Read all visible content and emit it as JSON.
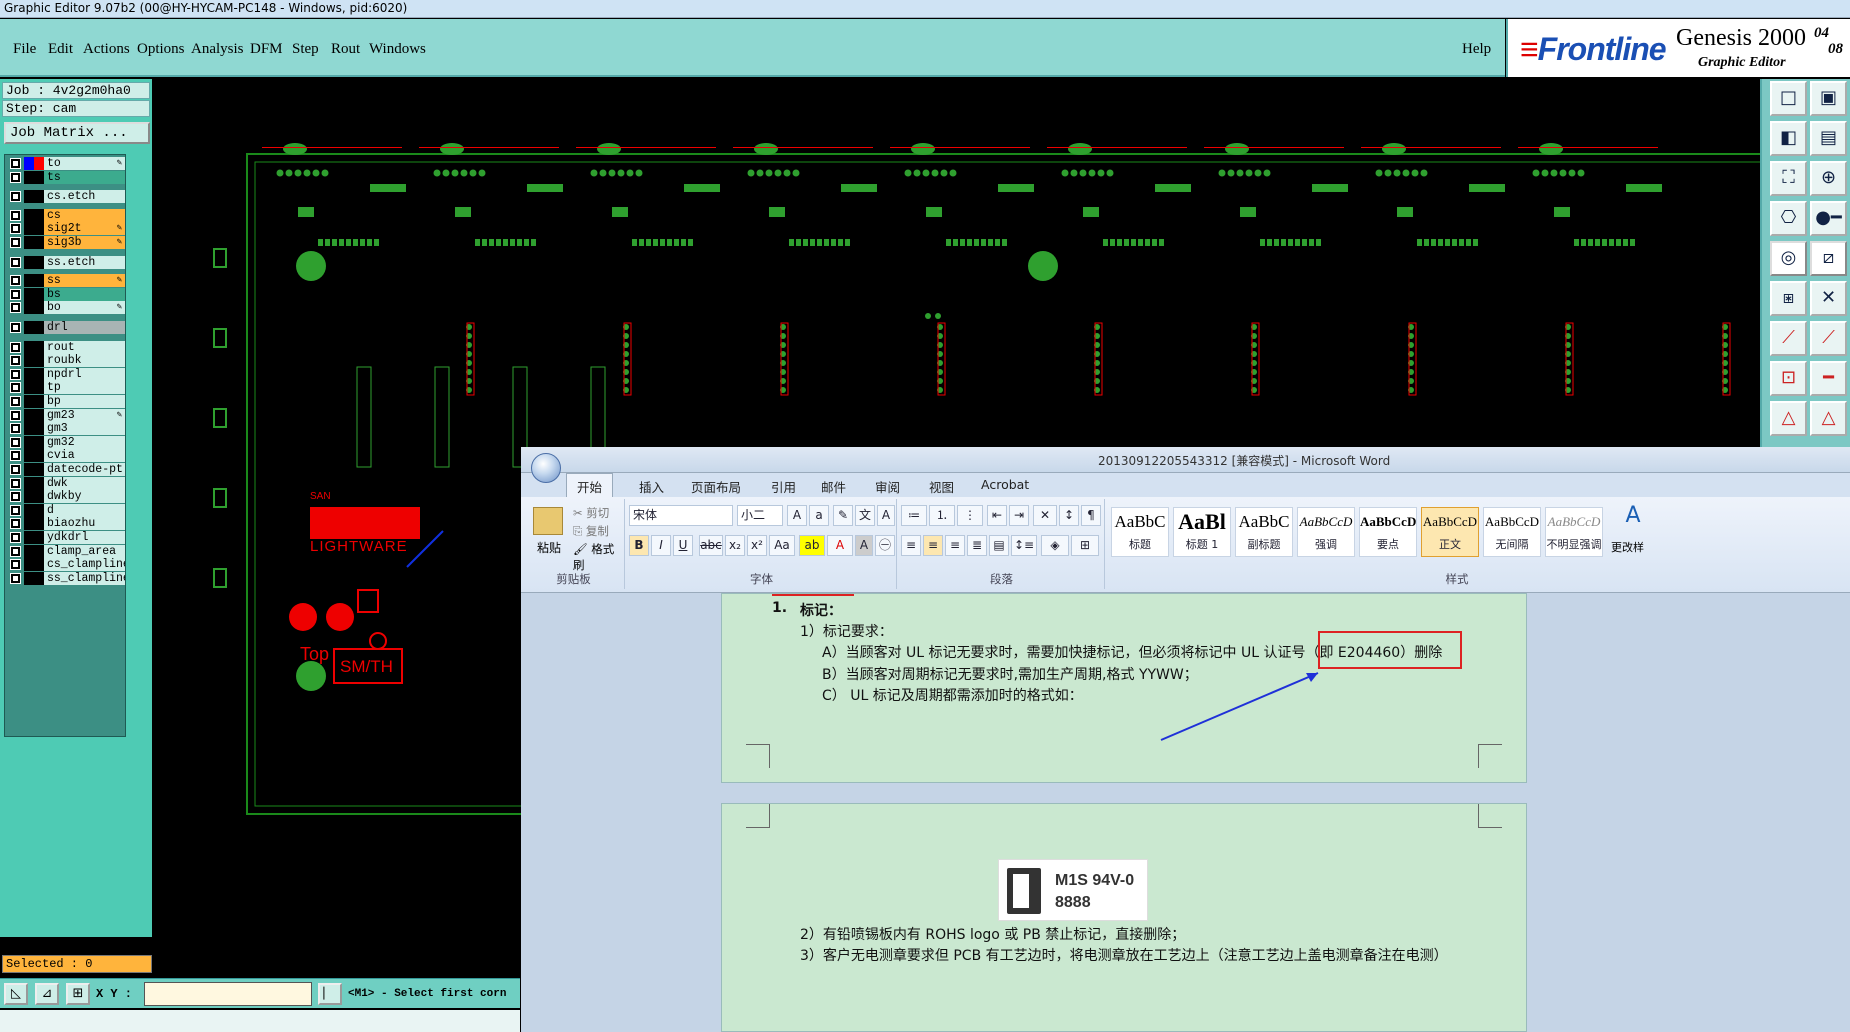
{
  "window": {
    "title": "Graphic Editor 9.07b2 (00@HY-HYCAM-PC148 - Windows, pid:6020)"
  },
  "menu": {
    "items": [
      "File",
      "Edit",
      "Actions",
      "Options",
      "Analysis",
      "DFM",
      "Step",
      "Rout",
      "Windows"
    ],
    "help": "Help"
  },
  "brand": {
    "logo": "Frontline",
    "product": "Genesis 2000",
    "subtitle": "Graphic Editor",
    "date1": "04",
    "date2": "08"
  },
  "job": {
    "job_label": "Job : 4v2g2m0ha0",
    "step_label": "Step: cam",
    "matrix_button": "Job Matrix ..."
  },
  "layers": [
    {
      "name": "to",
      "style": "white",
      "pen": true
    },
    {
      "name": "ts",
      "style": "green",
      "pen": false
    },
    {
      "name": "cs.etch",
      "style": "white",
      "pen": false
    },
    {
      "name": "cs",
      "style": "orange",
      "pen": false
    },
    {
      "name": "sig2t",
      "style": "orange",
      "pen": true
    },
    {
      "name": "sig3b",
      "style": "orange",
      "pen": true
    },
    {
      "name": "ss.etch",
      "style": "white",
      "pen": false
    },
    {
      "name": "ss",
      "style": "orange",
      "pen": true
    },
    {
      "name": "bs",
      "style": "green",
      "pen": false
    },
    {
      "name": "bo",
      "style": "white",
      "pen": true
    },
    {
      "name": "drl",
      "style": "gray",
      "pen": false
    },
    {
      "name": "rout",
      "style": "white",
      "pen": false
    },
    {
      "name": "roubk",
      "style": "white",
      "pen": false
    },
    {
      "name": "npdrl",
      "style": "white",
      "pen": false
    },
    {
      "name": "tp",
      "style": "white",
      "pen": false
    },
    {
      "name": "bp",
      "style": "white",
      "pen": false
    },
    {
      "name": "gm23",
      "style": "white",
      "pen": true
    },
    {
      "name": "gm3",
      "style": "white",
      "pen": false
    },
    {
      "name": "gm32",
      "style": "white",
      "pen": false
    },
    {
      "name": "cvia",
      "style": "white",
      "pen": false
    },
    {
      "name": "datecode-pt",
      "style": "white",
      "pen": false
    },
    {
      "name": "dwk",
      "style": "white",
      "pen": false
    },
    {
      "name": "dwkby",
      "style": "white",
      "pen": false
    },
    {
      "name": "d",
      "style": "white",
      "pen": false
    },
    {
      "name": "biaozhu",
      "style": "white",
      "pen": false
    },
    {
      "name": "ydkdrl",
      "style": "white",
      "pen": false
    },
    {
      "name": "clamp_area",
      "style": "white",
      "pen": false
    },
    {
      "name": "cs_clampline",
      "style": "white",
      "pen": false
    },
    {
      "name": "ss_clampline",
      "style": "white",
      "pen": false
    }
  ],
  "status": {
    "selected": "Selected : 0",
    "xy_label": "X Y :",
    "xy_value": "",
    "prompt": "<M1> - Select first corn"
  },
  "pcb": {
    "texts": {
      "lightware": "LIGHTWARE",
      "top": "Top",
      "smth": "SM/TH",
      "san": "SAN"
    }
  },
  "word": {
    "title": "20130912205543312 [兼容模式] - Microsoft Word",
    "tabs": [
      "开始",
      "插入",
      "页面布局",
      "引用",
      "邮件",
      "审阅",
      "视图",
      "Acrobat"
    ],
    "clipboard": {
      "paste": "粘贴",
      "cut": "剪切",
      "copy": "复制",
      "format_painter": "格式刷",
      "label": "剪贴板"
    },
    "font": {
      "name": "宋体",
      "size": "小二",
      "label": "字体"
    },
    "paragraph": {
      "label": "段落"
    },
    "styles": {
      "label": "样式",
      "items": [
        {
          "preview": "AaBbC",
          "name": "标题"
        },
        {
          "preview": "AaBl",
          "name": "标题 1"
        },
        {
          "preview": "AaBbC",
          "name": "副标题"
        },
        {
          "preview": "AaBbCcD",
          "name": "强调"
        },
        {
          "preview": "AaBbCcD",
          "name": "要点"
        },
        {
          "preview": "AaBbCcD",
          "name": "正文"
        },
        {
          "preview": "AaBbCcD",
          "name": "无间隔"
        },
        {
          "preview": "AaBbCcD",
          "name": "不明显强调"
        }
      ],
      "change": "更改样"
    },
    "doc": {
      "heading_num": "1.",
      "heading": "标记：",
      "l1": "1）标记要求：",
      "a": "A）当顾客对 UL 标记无要求时，需要加快捷标记，但必须将标记中 UL 认证号（即 E204460）删除",
      "b": "B）当顾客对周期标记无要求时,需加生产周期,格式 YYWW；",
      "c": "C） UL 标记及周期都需添加时的格式如：",
      "logo_text": "M1S 94V-0",
      "logo_num": "8888",
      "l2": "2）有铅喷锡板内有 ROHS logo 或 PB 禁止标记，直接删除；",
      "l3": "3）客户无电测章要求但 PCB 有工艺边时，将电测章放在工艺边上（注意工艺边上盖电测章备注在电测）"
    }
  }
}
